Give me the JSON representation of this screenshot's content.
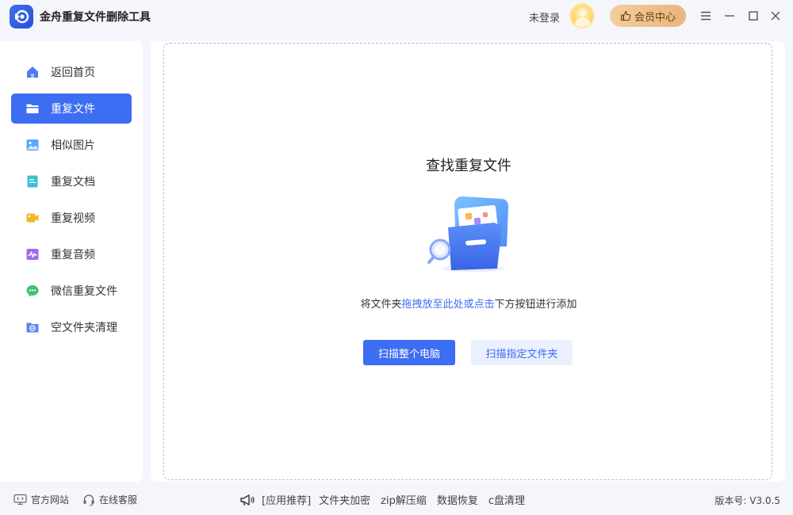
{
  "app": {
    "title": "金舟重复文件删除工具",
    "login_status": "未登录",
    "vip_label": "会员中心"
  },
  "sidebar": {
    "items": [
      {
        "label": "返回首页",
        "icon": "home-icon",
        "active": false
      },
      {
        "label": "重复文件",
        "icon": "folder-icon",
        "active": true
      },
      {
        "label": "相似图片",
        "icon": "image-icon",
        "active": false
      },
      {
        "label": "重复文档",
        "icon": "document-icon",
        "active": false
      },
      {
        "label": "重复视频",
        "icon": "video-icon",
        "active": false
      },
      {
        "label": "重复音频",
        "icon": "audio-icon",
        "active": false
      },
      {
        "label": "微信重复文件",
        "icon": "wechat-icon",
        "active": false
      },
      {
        "label": "空文件夹清理",
        "icon": "empty-folder-icon",
        "active": false
      }
    ]
  },
  "main": {
    "title": "查找重复文件",
    "hint_prefix": "将文件夹",
    "hint_link": "拖拽放至此处或点击",
    "hint_suffix": "下方按钮进行添加",
    "scan_all_label": "扫描整个电脑",
    "scan_folder_label": "扫描指定文件夹"
  },
  "footer": {
    "official_site": "官方网站",
    "online_service": "在线客服",
    "promo_tag": "[应用推荐]",
    "promo_items": [
      "文件夹加密",
      "zip解压缩",
      "数据恢复",
      "c盘清理"
    ],
    "version": "版本号: V3.0.5"
  },
  "colors": {
    "accent": "#3d6df2",
    "background": "#f4f6fb",
    "vip_gold": "#e9b57a"
  }
}
